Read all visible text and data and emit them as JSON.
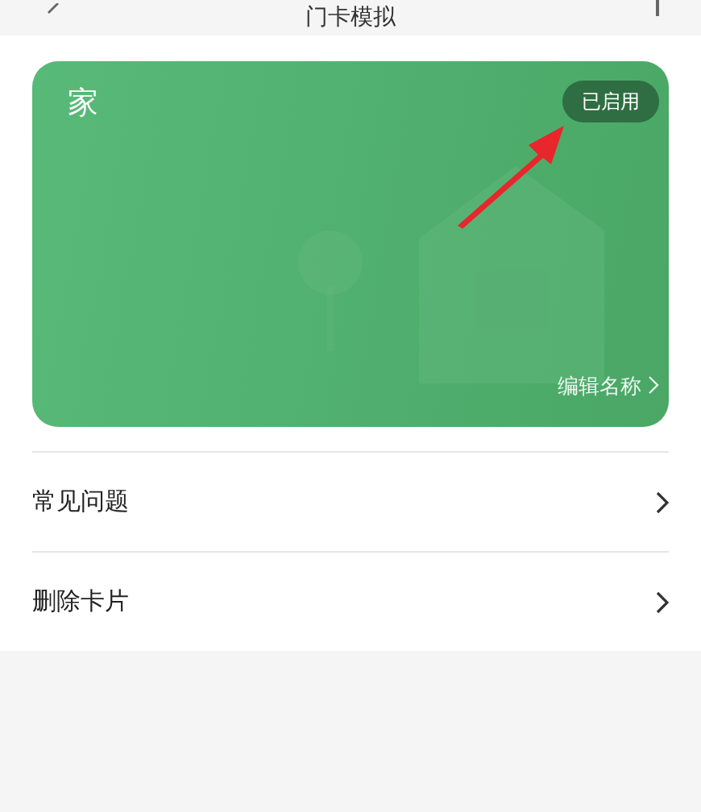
{
  "header": {
    "title": "门卡模拟"
  },
  "card": {
    "name": "家",
    "status": "已启用",
    "enabled": true,
    "edit_label": "编辑名称"
  },
  "menu": [
    {
      "label": "常见问题"
    },
    {
      "label": "删除卡片"
    }
  ]
}
